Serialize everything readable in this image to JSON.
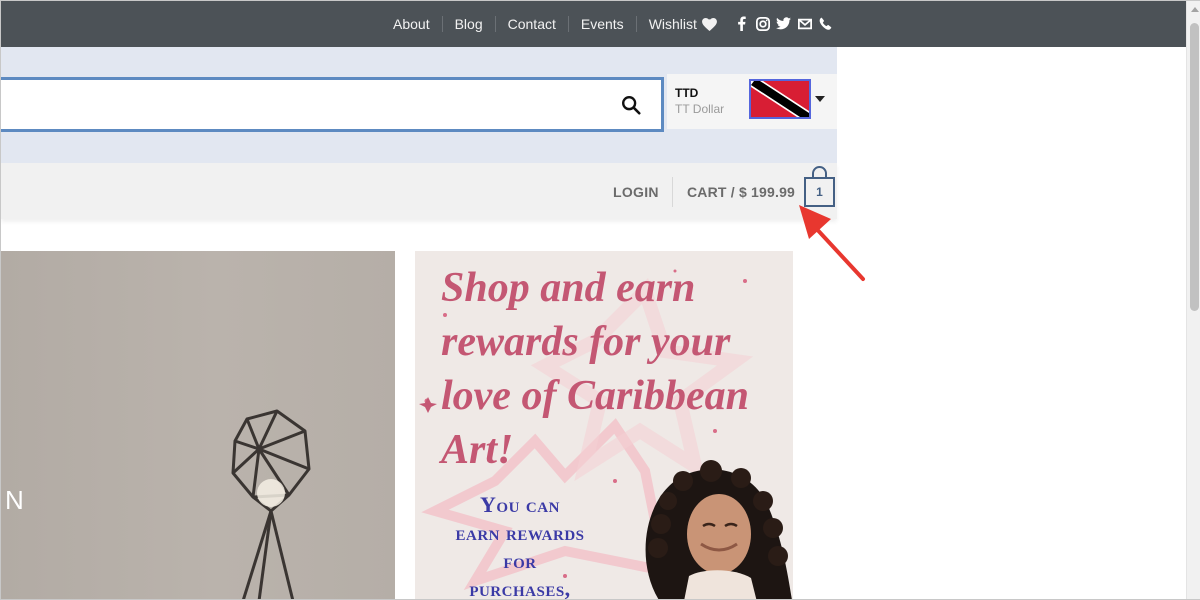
{
  "topnav": {
    "items": [
      "About",
      "Blog",
      "Contact",
      "Events",
      "Wishlist"
    ],
    "social_icons": [
      "facebook-icon",
      "instagram-icon",
      "twitter-icon",
      "email-icon",
      "phone-icon"
    ]
  },
  "search": {
    "value": "",
    "placeholder": "",
    "icon": "search-icon"
  },
  "currency": {
    "code": "TTD",
    "name": "TT Dollar",
    "flag": "trinidad-and-tobago-flag"
  },
  "account": {
    "login_label": "LOGIN"
  },
  "cart": {
    "label": "CART / $ 199.99",
    "count": "1"
  },
  "left_banner": {
    "partial_text": "N"
  },
  "promo": {
    "headline_lines": [
      "Shop and earn",
      "rewards for your",
      "love of Caribbean",
      "Art!"
    ],
    "sub_lines": [
      "You can",
      "earn rewards",
      "for",
      "purchases,"
    ]
  },
  "colors": {
    "topbar": "#4c5257",
    "header": "#e2e7f1",
    "accent": "#446084",
    "promo_pink": "#c45773",
    "promo_blue": "#3b3aa6",
    "annotation": "#e8372f"
  }
}
